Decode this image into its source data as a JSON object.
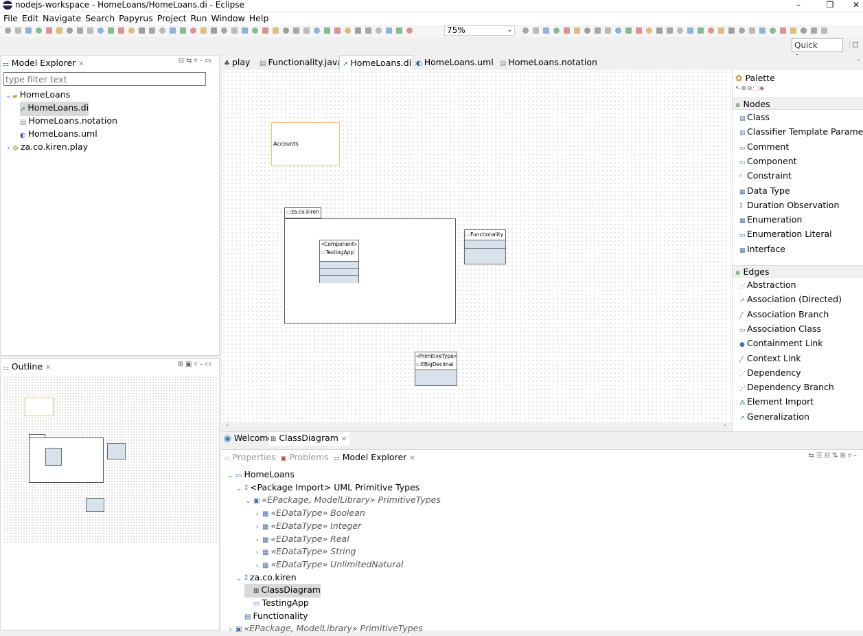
{
  "window": {
    "title": "nodejs-workspace - HomeLoans/HomeLoans.di - Eclipse",
    "min": "–",
    "max": "❐",
    "close": "✕"
  },
  "menu": [
    "File",
    "Edit",
    "Navigate",
    "Search",
    "Papyrus",
    "Project",
    "Run",
    "Window",
    "Help"
  ],
  "toolbar": {
    "zoom": "75%",
    "quick_access": "Quick Access"
  },
  "model_explorer": {
    "title": "Model Explorer",
    "filter_placeholder": "type filter text",
    "tree": [
      {
        "label": "HomeLoans",
        "twisty": "⌄"
      },
      {
        "label": "HomeLoans.di",
        "selected": true
      },
      {
        "label": "HomeLoans.notation"
      },
      {
        "label": "HomeLoans.uml"
      },
      {
        "label": "za.co.kiren.play",
        "twisty": "›"
      }
    ]
  },
  "outline": {
    "title": "Outline"
  },
  "editor_tabs": [
    "play",
    "Functionality.java",
    "HomeLoans.di",
    "HomeLoans.uml",
    "HomeLoans.notation"
  ],
  "diagram": {
    "accounts": "Accounts",
    "package": "za.co.kiren",
    "component_stereo": "«Component»",
    "component_name": "TestingApp",
    "functionality": "Functionality",
    "prim_stereo": "«PrimitiveType»",
    "prim_name": "EBigDecimal"
  },
  "diagram_tabs": [
    "Welcome",
    "ClassDiagram"
  ],
  "palette": {
    "title": "Palette",
    "nodes_title": "Nodes",
    "nodes": [
      "Class",
      "Classifier Template Parameter",
      "Comment",
      "Component",
      "Constraint",
      "Data Type",
      "Duration Observation",
      "Enumeration",
      "Enumeration Literal",
      "Interface"
    ],
    "edges_title": "Edges",
    "edges": [
      "Abstraction",
      "Association (Directed)",
      "Association Branch",
      "Association Class",
      "Containment Link",
      "Context Link",
      "Dependency",
      "Dependency Branch",
      "Element Import",
      "Generalization"
    ]
  },
  "bottom_tabs": [
    "Properties",
    "Problems",
    "Model Explorer"
  ],
  "bottom_tree": [
    {
      "label": "HomeLoans",
      "twisty": "⌄",
      "indent": 0
    },
    {
      "label": "<Package Import> UML Primitive Types",
      "twisty": "⌄",
      "indent": 1
    },
    {
      "label": "«EPackage, ModelLibrary» PrimitiveTypes",
      "twisty": "⌄",
      "indent": 2,
      "italic": true
    },
    {
      "label": "«EDataType» Boolean",
      "twisty": "›",
      "indent": 3,
      "italic": true
    },
    {
      "label": "«EDataType» Integer",
      "twisty": "›",
      "indent": 3,
      "italic": true
    },
    {
      "label": "«EDataType» Real",
      "twisty": "›",
      "indent": 3,
      "italic": true
    },
    {
      "label": "«EDataType» String",
      "twisty": "›",
      "indent": 3,
      "italic": true
    },
    {
      "label": "«EDataType» UnlimitedNatural",
      "twisty": "›",
      "indent": 3,
      "italic": true
    },
    {
      "label": "za.co.kiren",
      "twisty": "⌄",
      "indent": 1
    },
    {
      "label": "ClassDiagram",
      "indent": 2,
      "selected": true
    },
    {
      "label": "TestingApp",
      "indent": 2
    },
    {
      "label": "Functionality",
      "indent": 1
    },
    {
      "label": "«EPackage, ModelLibrary» PrimitiveTypes",
      "twisty": "›",
      "indent": 0,
      "italic": true
    }
  ],
  "colors": {
    "selection": "#d9d9d9",
    "diagram_class_fill": "#d8e2ec",
    "accounts_border": "#f5c07a"
  }
}
